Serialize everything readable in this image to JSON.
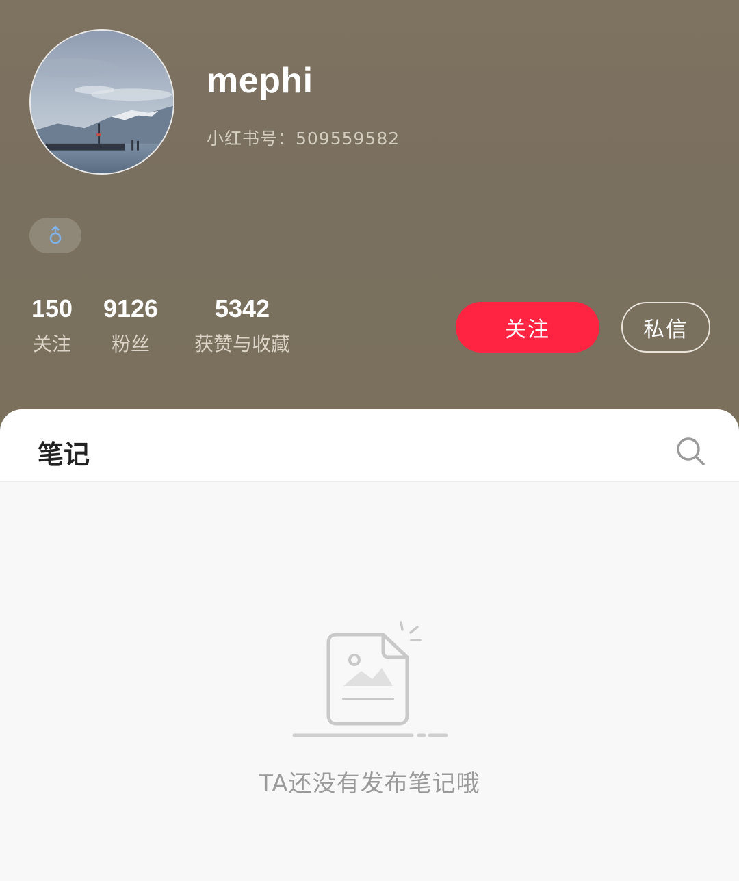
{
  "profile": {
    "username": "mephi",
    "user_id": "小红书号：509559582",
    "gender_icon": "male-icon"
  },
  "stats": {
    "following": {
      "value": "150",
      "label": "关注"
    },
    "followers": {
      "value": "9126",
      "label": "粉丝"
    },
    "likes": {
      "value": "5342",
      "label": "获赞与收藏"
    }
  },
  "actions": {
    "follow_label": "关注",
    "message_label": "私信"
  },
  "tabs": {
    "notes_label": "笔记",
    "search_icon": "search-icon"
  },
  "empty_state": {
    "message": "TA还没有发布笔记哦",
    "icon": "empty-image-note-icon"
  },
  "colors": {
    "header_bg": "#7b705e",
    "accent": "#ff2442",
    "gender_icon": "#7fb3e8"
  }
}
